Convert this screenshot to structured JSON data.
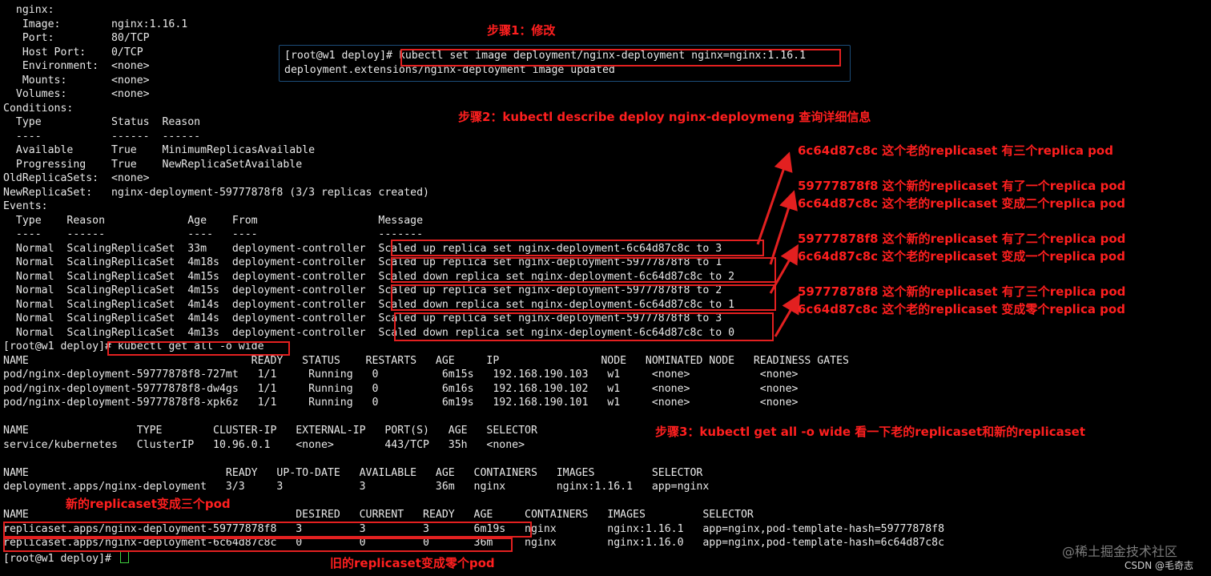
{
  "terminal": {
    "lines": [
      "  nginx:",
      "   Image:        nginx:1.16.1",
      "   Port:         80/TCP",
      "   Host Port:    0/TCP",
      "   Environment:  <none>",
      "   Mounts:       <none>",
      "  Volumes:       <none>",
      "Conditions:",
      "  Type           Status  Reason",
      "  ----           ------  ------",
      "  Available      True    MinimumReplicasAvailable",
      "  Progressing    True    NewReplicaSetAvailable",
      "OldReplicaSets:  <none>",
      "NewReplicaSet:   nginx-deployment-59777878f8 (3/3 replicas created)",
      "Events:",
      "  Type    Reason             Age    From                   Message",
      "  ----    ------             ----   ----                   -------",
      "  Normal  ScalingReplicaSet  33m    deployment-controller  Scaled up replica set nginx-deployment-6c64d87c8c to 3",
      "  Normal  ScalingReplicaSet  4m18s  deployment-controller  Scaled up replica set nginx-deployment-59777878f8 to 1",
      "  Normal  ScalingReplicaSet  4m15s  deployment-controller  Scaled down replica set nginx-deployment-6c64d87c8c to 2",
      "  Normal  ScalingReplicaSet  4m15s  deployment-controller  Scaled up replica set nginx-deployment-59777878f8 to 2",
      "  Normal  ScalingReplicaSet  4m14s  deployment-controller  Scaled down replica set nginx-deployment-6c64d87c8c to 1",
      "  Normal  ScalingReplicaSet  4m14s  deployment-controller  Scaled up replica set nginx-deployment-59777878f8 to 3",
      "  Normal  ScalingReplicaSet  4m13s  deployment-controller  Scaled down replica set nginx-deployment-6c64d87c8c to 0",
      "[root@w1 deploy]# kubectl get all -o wide",
      "NAME                                   READY   STATUS    RESTARTS   AGE     IP                NODE   NOMINATED NODE   READINESS GATES",
      "pod/nginx-deployment-59777878f8-727mt   1/1     Running   0          6m15s   192.168.190.103   w1     <none>           <none>",
      "pod/nginx-deployment-59777878f8-dw4gs   1/1     Running   0          6m16s   192.168.190.102   w1     <none>           <none>",
      "pod/nginx-deployment-59777878f8-xpk6z   1/1     Running   0          6m19s   192.168.190.101   w1     <none>           <none>",
      "",
      "NAME                 TYPE        CLUSTER-IP   EXTERNAL-IP   PORT(S)   AGE   SELECTOR",
      "service/kubernetes   ClusterIP   10.96.0.1    <none>        443/TCP   35h   <none>",
      "",
      "NAME                               READY   UP-TO-DATE   AVAILABLE   AGE   CONTAINERS   IMAGES         SELECTOR",
      "deployment.apps/nginx-deployment   3/3     3            3           36m   nginx        nginx:1.16.1   app=nginx",
      "",
      "NAME                                          DESIRED   CURRENT   READY   AGE     CONTAINERS   IMAGES         SELECTOR",
      "replicaset.apps/nginx-deployment-59777878f8   3         3         3       6m19s   nginx        nginx:1.16.1   app=nginx,pod-template-hash=59777878f8",
      "replicaset.apps/nginx-deployment-6c64d87c8c   0         0         0       36m     nginx        nginx:1.16.0   app=nginx,pod-template-hash=6c64d87c8c",
      "[root@w1 deploy]# "
    ]
  },
  "inset": {
    "line1": "[root@w1 deploy]# kubectl set image deployment/nginx-deployment nginx=nginx:1.16.1",
    "line2": "deployment.extensions/nginx-deployment image updated"
  },
  "annotations": {
    "step1": "步骤1：修改",
    "step2": "步骤2：kubectl describe deploy nginx-deploymeng 查询详细信息",
    "note_a": "6c64d87c8c 这个老的replicaset 有三个replica pod",
    "note_b1": "59777878f8 这个新的replicaset 有了一个replica pod",
    "note_b2": "6c64d87c8c 这个老的replicaset 变成二个replica pod",
    "note_c1": "59777878f8 这个新的replicaset 有了二个replica pod",
    "note_c2": "6c64d87c8c 这个老的replicaset 变成一个replica pod",
    "note_d1": "59777878f8 这个新的replicaset 有了三个replica pod",
    "note_d2": "6c64d87c8c 这个老的replicaset 变成零个replica pod",
    "step3": "步骤3：kubectl get all -o wide 看一下老的replicaset和新的replicaset",
    "new_rs": "新的replicaset变成三个pod",
    "old_rs": "旧的replicaset变成零个pod"
  },
  "watermark": {
    "juejin": "@稀土掘金技术社区",
    "csdn": "CSDN @毛奇志"
  },
  "colors": {
    "accent": "#ff1f1f",
    "cursor": "#3fd13f",
    "inset_border": "#1c4d7a"
  }
}
